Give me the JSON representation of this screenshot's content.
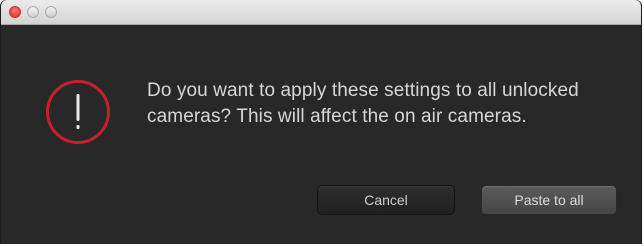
{
  "dialog": {
    "message": "Do you want to apply these settings to all unlocked cameras? This will affect the on air cameras.",
    "icon": "alert-exclamation-icon",
    "accent_color": "#c8202a"
  },
  "buttons": {
    "cancel_label": "Cancel",
    "confirm_label": "Paste to all"
  },
  "window_controls": {
    "close_color": "#e0443a",
    "inactive_color": "#d8d8d8"
  }
}
